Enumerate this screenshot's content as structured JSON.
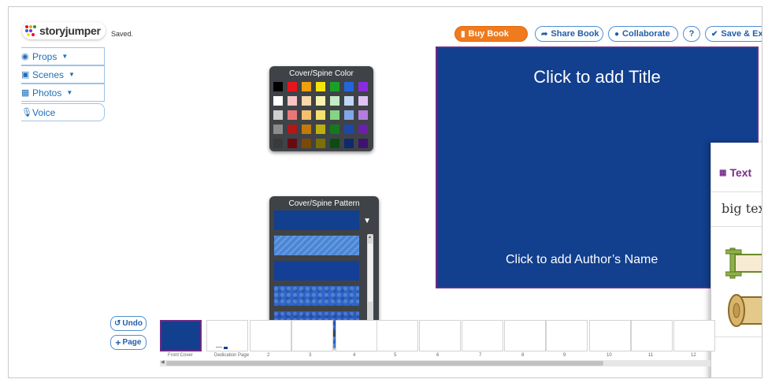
{
  "header": {
    "logo_text": "storyjumper",
    "save_status": "Saved."
  },
  "toolbar": {
    "buy_book": "Buy Book",
    "share_book": "Share Book",
    "collaborate": "Collaborate",
    "help": "?",
    "save_exit": "Save & Exit"
  },
  "side_tools": [
    {
      "label": "Props"
    },
    {
      "label": "Scenes"
    },
    {
      "label": "Photos"
    },
    {
      "label": "Voice"
    }
  ],
  "cover_color_picker": {
    "title": "Cover/Spine Color",
    "swatches": [
      "#000000",
      "#e8141c",
      "#f0a00a",
      "#f5e40c",
      "#19a02a",
      "#2266dd",
      "#8a2be2",
      "#ffffff",
      "#f7c4c4",
      "#f8d7a8",
      "#f8f2b0",
      "#c4ecc4",
      "#c0d6f4",
      "#dcc4f4",
      "#cfcfcf",
      "#e87878",
      "#f4c06c",
      "#f2e070",
      "#84d484",
      "#80a8e8",
      "#b47ce0",
      "#8c8c8c",
      "#b01818",
      "#c47a08",
      "#bcb010",
      "#157a1e",
      "#1c48a8",
      "#6a20a8",
      "#3a3a3a",
      "#6a0a10",
      "#7a4a06",
      "#7a7008",
      "#0c4c12",
      "#0e2a6c",
      "#3e1270"
    ]
  },
  "cover_pattern_picker": {
    "title": "Cover/Spine Pattern",
    "patterns": [
      {
        "name": "navy-grid",
        "color": "#123f8e"
      },
      {
        "name": "light-diagonal",
        "color": "#4a86d6"
      },
      {
        "name": "navy-solid",
        "color": "#143f96"
      },
      {
        "name": "blue-texture",
        "color": "#2e66c8"
      },
      {
        "name": "blue-mottled",
        "color": "#2a5cc0"
      },
      {
        "name": "blue-bright",
        "color": "#3470d6"
      }
    ]
  },
  "cover": {
    "title_placeholder": "Click to add Title",
    "author_placeholder": "Click to add Author’s Name",
    "background": "#123f8e",
    "border_color": "#6b2c86"
  },
  "text_panel": {
    "heading": "Text",
    "big_text": "big tex"
  },
  "actions": {
    "undo": "Undo",
    "page": "Page"
  },
  "pages": [
    {
      "label": "Front Cover"
    },
    {
      "label": "Dedication Page"
    },
    {
      "label": "2"
    },
    {
      "label": "3"
    },
    {
      "label": "4"
    },
    {
      "label": "5"
    },
    {
      "label": "6"
    },
    {
      "label": "7"
    },
    {
      "label": "8"
    },
    {
      "label": "9"
    },
    {
      "label": "10"
    },
    {
      "label": "11"
    },
    {
      "label": "12"
    }
  ],
  "colors": {
    "accent_orange": "#f07a1e",
    "link_blue": "#1f5fa8",
    "panel_purple": "#7a2d8c"
  }
}
